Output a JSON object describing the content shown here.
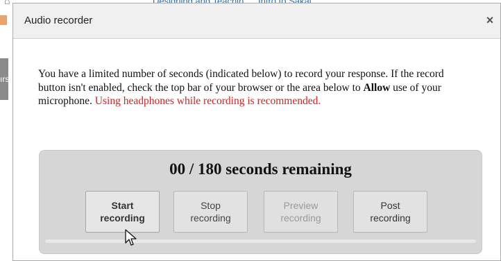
{
  "background": {
    "nav_items": [
      "Designing and Teachin",
      "Intro to Sakai"
    ],
    "side_tab": "ırs"
  },
  "dialog": {
    "title": "Audio recorder",
    "close_label": "×",
    "instructions_part1": "You have a limited number of seconds (indicated below) to record your response. If the record button isn't enabled, check the top bar of your browser or the area below to ",
    "instructions_bold": "Allow",
    "instructions_part2": " use of your microphone. ",
    "instructions_warning": "Using headphones while recording is recommended."
  },
  "recorder": {
    "elapsed": "00",
    "total": "180",
    "counter_text": "00 / 180 seconds remaining",
    "buttons": {
      "start": {
        "line1": "Start",
        "line2": "recording",
        "enabled": true
      },
      "stop": {
        "line1": "Stop",
        "line2": "recording",
        "enabled": true
      },
      "preview": {
        "line1": "Preview",
        "line2": "recording",
        "enabled": false
      },
      "post": {
        "line1": "Post",
        "line2": "recording",
        "enabled": true
      }
    },
    "progress_fraction": 0
  },
  "colors": {
    "warning": "#e01b1b",
    "panel": "#d6d6d6",
    "disabled_text": "#9a9a9a"
  }
}
